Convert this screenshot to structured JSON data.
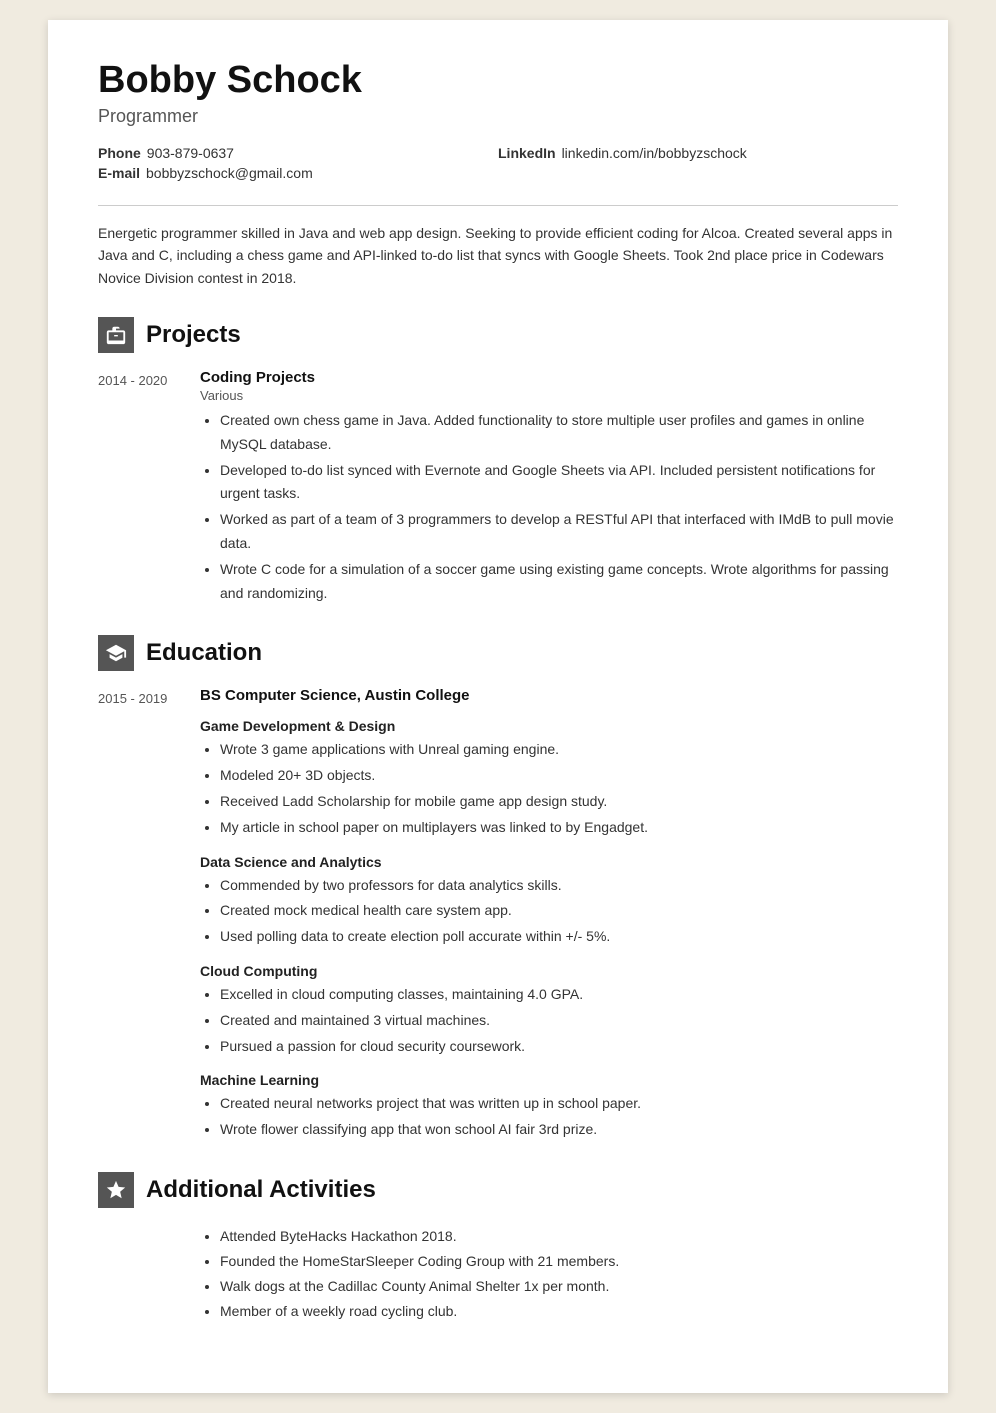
{
  "header": {
    "name": "Bobby Schock",
    "title": "Programmer"
  },
  "contact": {
    "phone_label": "Phone",
    "phone": "903-879-0637",
    "linkedin_label": "LinkedIn",
    "linkedin": "linkedin.com/in/bobbyzschock",
    "email_label": "E-mail",
    "email": "bobbyzschock@gmail.com"
  },
  "summary": "Energetic programmer skilled in Java and web app design. Seeking to provide efficient coding for Alcoa. Created several apps in Java and C, including a chess game and API-linked to-do list that syncs with Google Sheets. Took 2nd place price in Codewars Novice Division contest in 2018.",
  "sections": {
    "projects_title": "Projects",
    "education_title": "Education",
    "activities_title": "Additional Activities"
  },
  "projects": [
    {
      "dates": "2014 - 2020",
      "title": "Coding Projects",
      "subtitle": "Various",
      "bullets": [
        "Created own chess game in Java. Added functionality to store multiple user profiles and games in online MySQL database.",
        "Developed to-do list synced with Evernote and Google Sheets via API. Included persistent notifications for urgent tasks.",
        "Worked as part of a team of 3 programmers to develop a RESTful API that interfaced with IMdB to pull movie data.",
        "Wrote C code for a simulation of a soccer game using existing game concepts. Wrote algorithms for passing and randomizing."
      ]
    }
  ],
  "education": [
    {
      "dates": "2015 - 2019",
      "title": "BS Computer Science, Austin College",
      "subsections": [
        {
          "heading": "Game Development & Design",
          "bullets": [
            "Wrote 3 game applications with Unreal gaming engine.",
            "Modeled 20+ 3D objects.",
            "Received Ladd Scholarship for mobile game app design study.",
            "My article in school paper on multiplayers was linked to by Engadget."
          ]
        },
        {
          "heading": "Data Science and Analytics",
          "bullets": [
            "Commended by two professors for data analytics skills.",
            "Created mock medical health care system app.",
            "Used polling data to create election poll accurate within +/- 5%."
          ]
        },
        {
          "heading": "Cloud Computing",
          "bullets": [
            "Excelled in cloud computing classes, maintaining 4.0 GPA.",
            "Created and maintained 3 virtual machines.",
            "Pursued a passion for cloud security coursework."
          ]
        },
        {
          "heading": "Machine Learning",
          "bullets": [
            "Created neural networks project that was written up in school paper.",
            "Wrote flower classifying app that won school AI fair 3rd prize."
          ]
        }
      ]
    }
  ],
  "activities": [
    "Attended ByteHacks Hackathon 2018.",
    "Founded the HomeStarSleeper Coding Group with 21 members.",
    "Walk dogs at the Cadillac County Animal Shelter 1x per month.",
    "Member of a weekly road cycling club."
  ]
}
